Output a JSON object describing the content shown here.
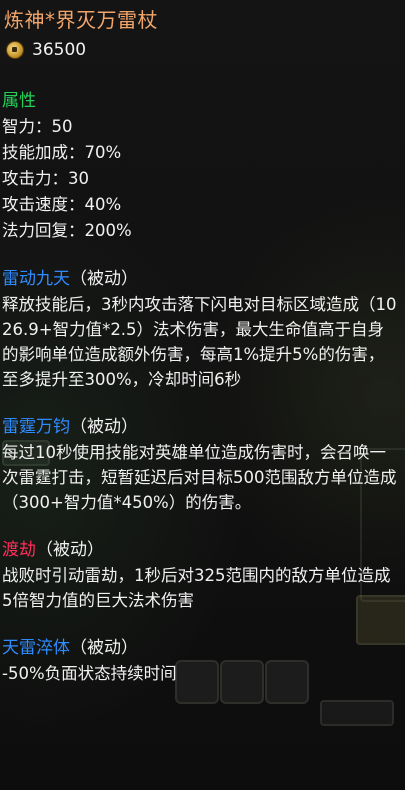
{
  "item": {
    "title": "炼神*界灭万雷杖",
    "price": "36500",
    "coin_icon": "gold-coin-icon",
    "title_color": "#f2a56a"
  },
  "attributes": {
    "heading": "属性",
    "heading_color": "#25d05a",
    "lines": [
      "智力：50",
      "技能加成：70%",
      "攻击力：30",
      "攻击速度：40%",
      "法力回复：200%"
    ]
  },
  "skills": [
    {
      "name": "雷动九天",
      "tag": "（被动）",
      "color": "#2f8cff",
      "desc": "释放技能后，3秒内攻击落下闪电对目标区域造成（1026.9+智力值*2.5）法术伤害，最大生命值高于自身的影响单位造成额外伤害，每高1%提升5%的伤害，至多提升至300%，冷却时间6秒"
    },
    {
      "name": "雷霆万钧",
      "tag": "（被动）",
      "color": "#2f8cff",
      "desc": "每过10秒使用技能对英雄单位造成伤害时，会召唤一次雷霆打击，短暂延迟后对目标500范围敌方单位造成（300+智力值*450%）的伤害。"
    },
    {
      "name": "渡劫",
      "tag": "（被动）",
      "color": "#ff2e5a",
      "desc": "战败时引动雷劫，1秒后对325范围内的敌方单位造成5倍智力值的巨大法术伤害"
    },
    {
      "name": "天雷淬体",
      "tag": "（被动）",
      "color": "#2f8cff",
      "desc": "-50%负面状态持续时间"
    }
  ]
}
